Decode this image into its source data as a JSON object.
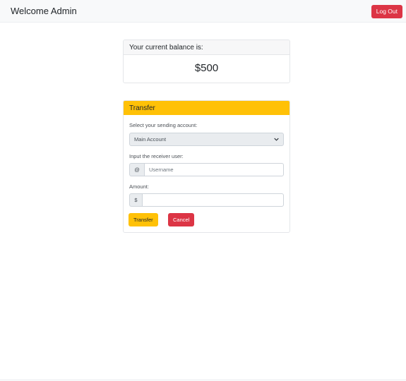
{
  "navbar": {
    "title": "Welcome Admin",
    "logout_label": "Log Out"
  },
  "balance": {
    "header": "Your current balance is:",
    "value": "$500"
  },
  "transfer": {
    "header": "Transfer",
    "account_label": "Select your sending account:",
    "account_selected": "Main Account",
    "receiver_label": "Input the receiver user:",
    "receiver_prefix": "@",
    "receiver_placeholder": "Username",
    "amount_label": "Amount:",
    "amount_prefix": "$",
    "amount_value": "",
    "submit_label": "Transfer",
    "cancel_label": "Cancel"
  },
  "colors": {
    "warning": "#ffc107",
    "danger": "#dc3545",
    "navbar_bg": "#f8f9fa"
  },
  "icons": {
    "select_arrow": "chevron-down-icon"
  }
}
